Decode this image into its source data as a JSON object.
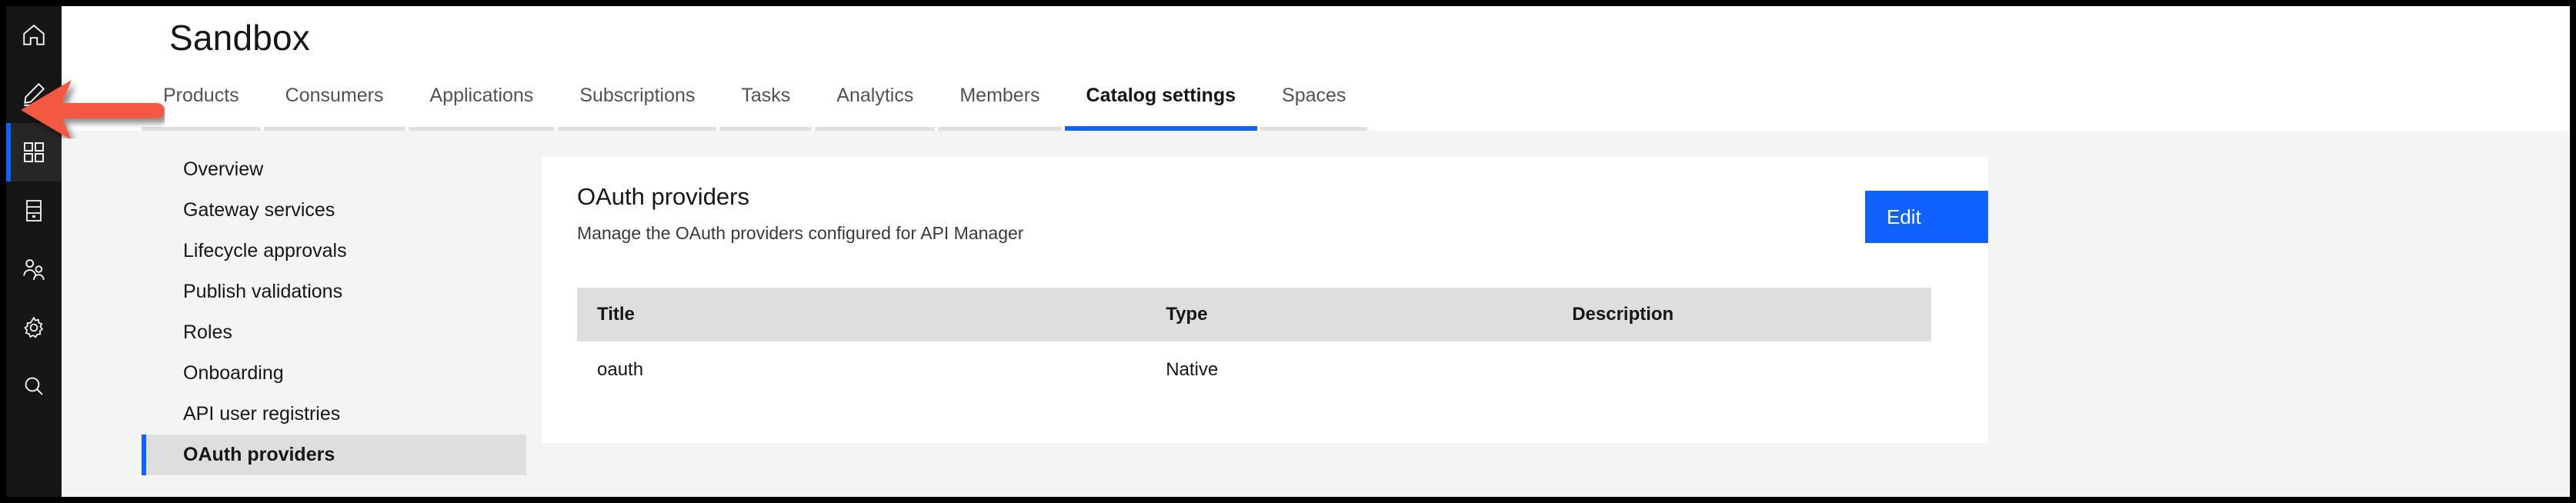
{
  "rail": {
    "items": [
      {
        "name": "home-icon",
        "label": "Home",
        "active": false
      },
      {
        "name": "edit-icon",
        "label": "Design",
        "active": false
      },
      {
        "name": "grid-icon",
        "label": "Manage",
        "active": true
      },
      {
        "name": "server-icon",
        "label": "Catalogs",
        "active": false
      },
      {
        "name": "users-icon",
        "label": "Members",
        "active": false
      },
      {
        "name": "gear-icon",
        "label": "Settings",
        "active": false
      },
      {
        "name": "search-icon",
        "label": "Search",
        "active": false
      }
    ]
  },
  "header": {
    "title": "Sandbox",
    "tabs": [
      {
        "label": "Products",
        "active": false
      },
      {
        "label": "Consumers",
        "active": false
      },
      {
        "label": "Applications",
        "active": false
      },
      {
        "label": "Subscriptions",
        "active": false
      },
      {
        "label": "Tasks",
        "active": false
      },
      {
        "label": "Analytics",
        "active": false
      },
      {
        "label": "Members",
        "active": false
      },
      {
        "label": "Catalog settings",
        "active": true
      },
      {
        "label": "Spaces",
        "active": false
      }
    ]
  },
  "subnav": {
    "items": [
      {
        "label": "Overview",
        "active": false
      },
      {
        "label": "Gateway services",
        "active": false
      },
      {
        "label": "Lifecycle approvals",
        "active": false
      },
      {
        "label": "Publish validations",
        "active": false
      },
      {
        "label": "Roles",
        "active": false
      },
      {
        "label": "Onboarding",
        "active": false
      },
      {
        "label": "API user registries",
        "active": false
      },
      {
        "label": "OAuth providers",
        "active": true
      }
    ]
  },
  "card": {
    "title": "OAuth providers",
    "subtitle": "Manage the OAuth providers configured for API Manager",
    "edit_label": "Edit",
    "table": {
      "columns": [
        "Title",
        "Type",
        "Description"
      ],
      "rows": [
        {
          "title": "oauth",
          "type": "Native",
          "description": ""
        }
      ]
    }
  },
  "annotation": {
    "arrow_color": "#f4593f",
    "points_to": "edit-icon"
  },
  "colors": {
    "accent_blue": "#0f62fe",
    "rail_bg": "#161616",
    "page_bg": "#f4f4f4",
    "table_head_bg": "#dedede"
  }
}
